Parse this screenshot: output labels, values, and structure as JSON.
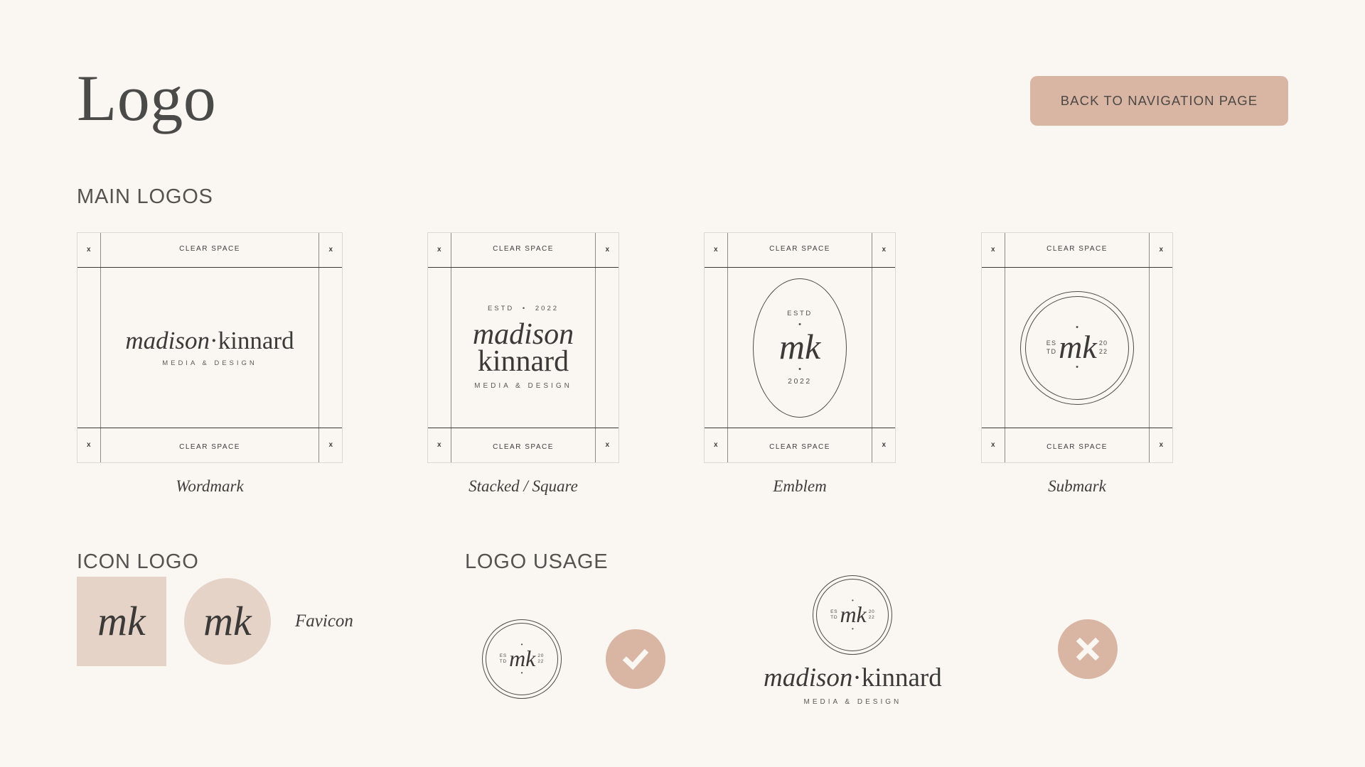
{
  "header": {
    "title": "Logo",
    "nav_button_label": "BACK TO NAVIGATION PAGE"
  },
  "sections": {
    "main_logos": "MAIN LOGOS",
    "icon_logo": "ICON LOGO",
    "logo_usage": "LOGO USAGE"
  },
  "clear_space": {
    "label": "CLEAR SPACE",
    "corner_mark": "x"
  },
  "brand": {
    "name_first": "madison",
    "name_separator": "·",
    "name_last": "kinnard",
    "tagline": "MEDIA & DESIGN",
    "estd_label": "ESTD",
    "estd_separator": "•",
    "year": "2022",
    "monogram": "mk",
    "estd_split_top": "ES",
    "estd_split_bottom": "TD",
    "year_split_top": "20",
    "year_split_bottom": "22",
    "dot": "•"
  },
  "cards": [
    {
      "caption": "Wordmark"
    },
    {
      "caption": "Stacked / Square"
    },
    {
      "caption": "Emblem"
    },
    {
      "caption": "Submark"
    }
  ],
  "icon_logo": {
    "square_monogram": "mk",
    "circle_monogram": "mk",
    "favicon_label": "Favicon"
  },
  "usage": {
    "correct_icon": "check-icon",
    "incorrect_icon": "cross-icon"
  },
  "colors": {
    "background": "#faf6f2",
    "accent": "#d9b5a4",
    "swatch_blush": "#e6d3c8",
    "ink": "#3b3a38",
    "heading": "#55534f",
    "rule_dark": "#3a3937",
    "rule_light": "#ded8d2"
  }
}
